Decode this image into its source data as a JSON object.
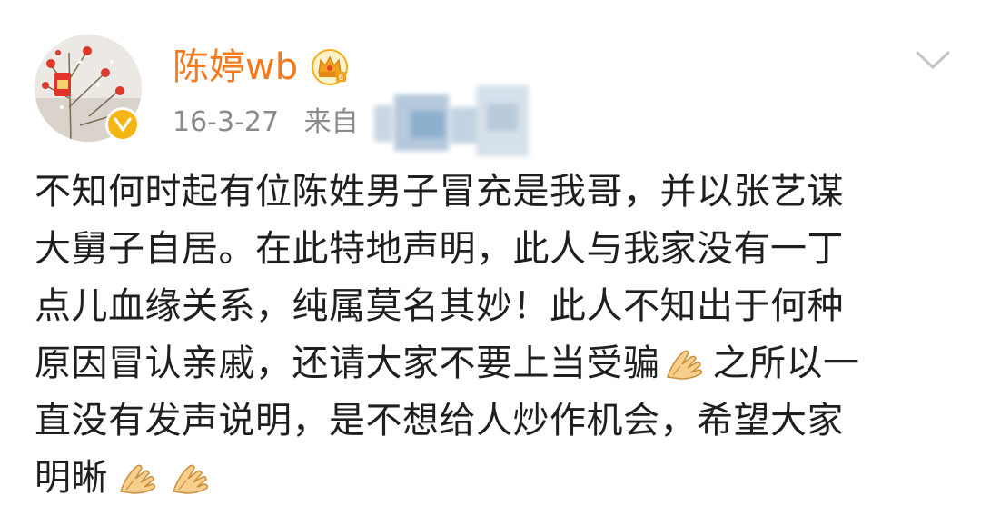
{
  "user": {
    "name": "陈婷wb",
    "time": "16-3-27",
    "source_prefix": "来自"
  },
  "icons": {
    "avatar": "avatar-image",
    "verified": "verified-badge-icon",
    "vip": "crown-vip-icon",
    "more": "chevron-down-icon",
    "emoji": "clasped-hands-emoji"
  },
  "colors": {
    "name": "#f37b1d",
    "meta": "#8a8a8a",
    "verified": "#f5b614"
  },
  "post": {
    "lines": [
      "不知何时起有位陈姓男子冒充是我哥，并以张艺谋",
      "大舅子自居。在此特地声明，此人与我家没有一丁",
      "点儿血缘关系，纯属莫名其妙！此人不知出于何种",
      "原因冒认亲戚，还请大家不要上当受骗",
      "之所以一",
      "直没有发声说明，是不想给人炒作机会，希望大家",
      "明晰"
    ]
  }
}
